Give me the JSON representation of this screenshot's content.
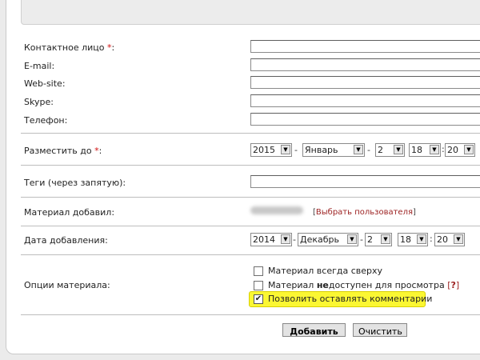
{
  "required_mark": "*",
  "fields": {
    "contact": "Контактное лицо ",
    "email": "E-mail:",
    "website": "Web-site:",
    "skype": "Skype:",
    "phone": "Телефон:",
    "place_until": "Разместить до ",
    "tags": "Теги (через запятую):",
    "added_by": "Материал добавил:",
    "date_added": "Дата добавления:",
    "options": "Опции материала:"
  },
  "colon": ":",
  "place_until": {
    "year": "2015",
    "month": "Январь",
    "day": "2",
    "hour": "18",
    "minute": "20"
  },
  "date_added": {
    "year": "2014",
    "month": "Декабрь",
    "day": "2",
    "hour": "18",
    "minute": "20"
  },
  "separators": {
    "dash": "-",
    "colon": ":"
  },
  "select_user_link": "Выбрать пользователя",
  "options": {
    "always_top": "Материал всегда сверху",
    "unavailable_prefix": "Материал ",
    "unavailable_bold": "не",
    "unavailable_suffix": "доступен для просмотра",
    "help_mark": "?",
    "allow_comments": "Позволить оставлять комментарии",
    "allow_comments_checked": true
  },
  "buttons": {
    "add": "Добавить",
    "clear": "Очистить"
  },
  "icons": {
    "dropdown": "chevron-down-icon",
    "check": "checkmark-icon"
  }
}
